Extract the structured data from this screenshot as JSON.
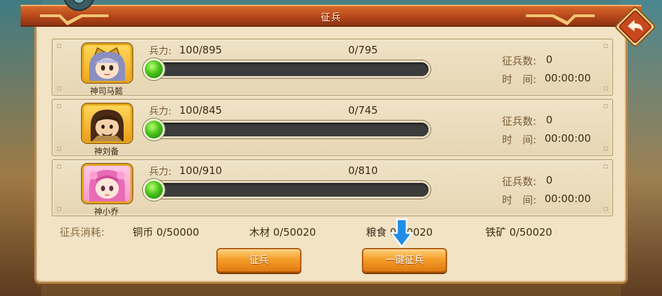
{
  "window": {
    "title": "征兵"
  },
  "heroes": [
    {
      "name": "神司马懿",
      "troop_label": "兵力:",
      "troop_value": "100/895",
      "recruit_ratio": "0/795",
      "recruit_count_label": "征兵数:",
      "recruit_count": "0",
      "time_label": "时　间:",
      "time": "00:00:00",
      "slider_fraction": 0
    },
    {
      "name": "神刘备",
      "troop_label": "兵力:",
      "troop_value": "100/845",
      "recruit_ratio": "0/745",
      "recruit_count_label": "征兵数:",
      "recruit_count": "0",
      "time_label": "时　间:",
      "time": "00:00:00",
      "slider_fraction": 0
    },
    {
      "name": "神小乔",
      "troop_label": "兵力:",
      "troop_value": "100/910",
      "recruit_ratio": "0/810",
      "recruit_count_label": "征兵数:",
      "recruit_count": "0",
      "time_label": "时　间:",
      "time": "00:00:00",
      "slider_fraction": 0
    }
  ],
  "cost": {
    "title": "征兵消耗:",
    "copper": "铜币 0/50000",
    "wood": "木材 0/50020",
    "grain": "粮食 0/50020",
    "iron": "铁矿 0/50020"
  },
  "buttons": {
    "recruit": "征兵",
    "recruit_all": "一键征兵"
  },
  "icons": {
    "back": "back-arrow-icon",
    "settings": "gear-icon",
    "hint": "down-arrow-icon"
  },
  "colors": {
    "title_bar": "#c0501e",
    "panel": "#f1e3c4",
    "slider_knob": "#49c31a",
    "button": "#f59d2a",
    "hint_arrow": "#1f8ee6"
  }
}
